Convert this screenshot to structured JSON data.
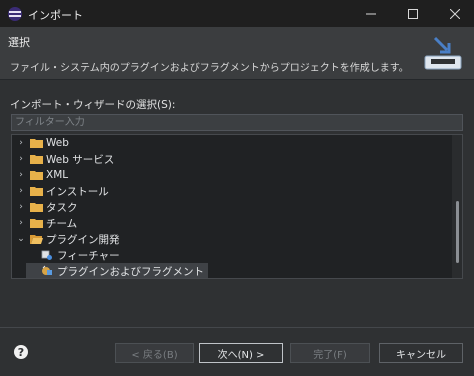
{
  "window": {
    "title": "インポート"
  },
  "banner": {
    "title": "選択",
    "description": "ファイル・システム内のプラグインおよびフラグメントからプロジェクトを作成します。"
  },
  "wizard": {
    "select_label": "インポート・ウィザードの選択(S):",
    "filter_placeholder": "フィルター入力",
    "filter_value": ""
  },
  "tree": {
    "items": [
      {
        "label": "Web",
        "expanded": false,
        "icon": "folder-icon"
      },
      {
        "label": "Web サービス",
        "expanded": false,
        "icon": "folder-icon"
      },
      {
        "label": "XML",
        "expanded": false,
        "icon": "folder-icon"
      },
      {
        "label": "インストール",
        "expanded": false,
        "icon": "folder-icon"
      },
      {
        "label": "タスク",
        "expanded": false,
        "icon": "folder-icon"
      },
      {
        "label": "チーム",
        "expanded": false,
        "icon": "folder-icon"
      },
      {
        "label": "プラグイン開発",
        "expanded": true,
        "icon": "folder-open-icon"
      },
      {
        "label": "フィーチャー",
        "icon": "feature-icon"
      },
      {
        "label": "プラグインおよびフラグメント",
        "icon": "plugin-icon",
        "selected": true
      }
    ]
  },
  "buttons": {
    "back": "< 戻る(B)",
    "next": "次へ(N) >",
    "finish": "完了(F)",
    "cancel": "キャンセル"
  },
  "colors": {
    "folder": "#e7b14a",
    "background": "#2f3133",
    "titlebar": "#1f1f1f"
  }
}
